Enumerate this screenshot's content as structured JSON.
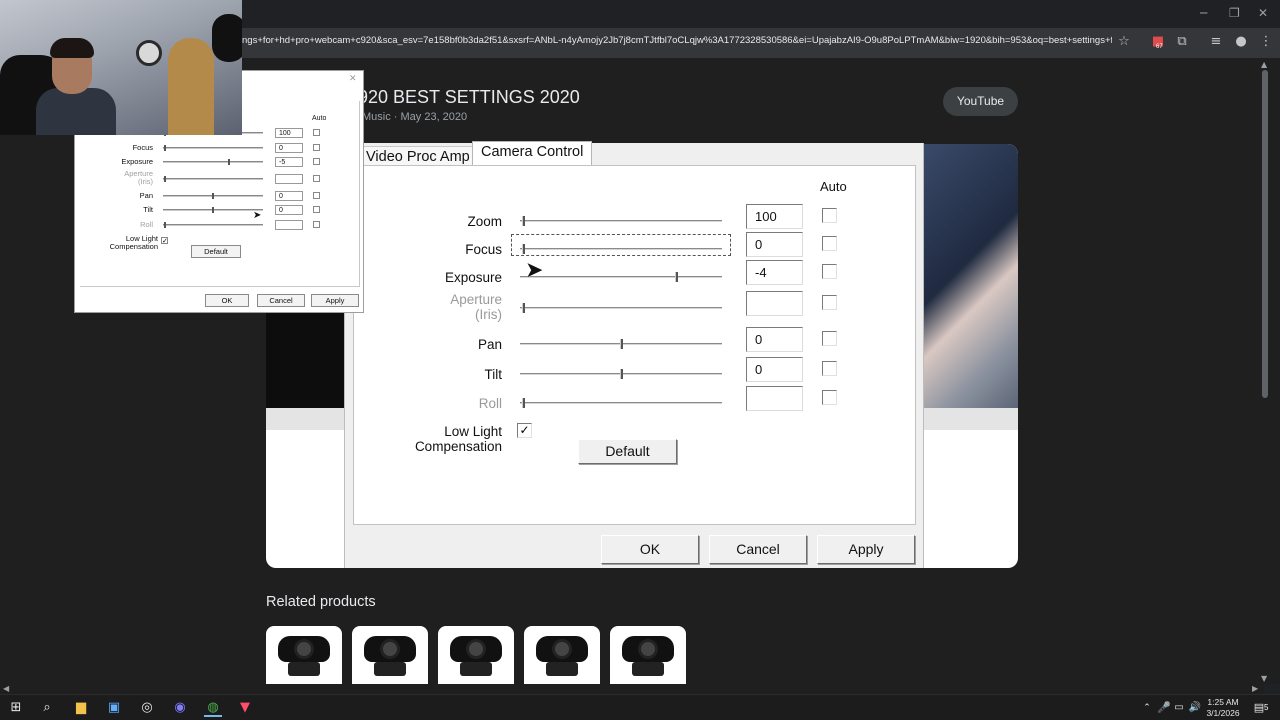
{
  "browser": {
    "url": "ngs+for+hd+pro+webcam+c920&sca_esv=7e158bf0b3da2f51&sxsrf=ANbL-n4yAmojy2Jb7j8cmTJtfbl7oCLqjw%3A1772328530586&ei=UpajabzAI9-O9u8PoLPTmAM&biw=1920&bih=953&oq=best+settings+f...",
    "extensions_badge": "67"
  },
  "video": {
    "title": "920 BEST SETTINGS 2020",
    "meta": "Music · May 23, 2020",
    "source_button": "YouTube"
  },
  "big_dialog": {
    "tab_inactive": "Video Proc Amp",
    "tab_active": "Camera Control",
    "auto_header": "Auto",
    "rows": [
      {
        "label": "Zoom",
        "value": "100",
        "disabled": false,
        "thumb": 0.0
      },
      {
        "label": "Focus",
        "value": "0",
        "disabled": false,
        "thumb": 0.0
      },
      {
        "label": "Exposure",
        "value": "-4",
        "disabled": false,
        "thumb": 0.78
      },
      {
        "label": "Aperture\n(Iris)",
        "value": "",
        "disabled": true,
        "thumb": 0.0
      },
      {
        "label": "Pan",
        "value": "0",
        "disabled": false,
        "thumb": 0.5
      },
      {
        "label": "Tilt",
        "value": "0",
        "disabled": false,
        "thumb": 0.5
      },
      {
        "label": "Roll",
        "value": "",
        "disabled": true,
        "thumb": 0.0
      }
    ],
    "low_light_label_1": "Low Light",
    "low_light_label_2": "Compensation",
    "low_light_checked": "✓",
    "default_button": "Default",
    "ok_button": "OK",
    "cancel_button": "Cancel",
    "apply_button": "Apply"
  },
  "small_dialog": {
    "auto_header": "Auto",
    "rows": [
      {
        "label": "",
        "value": "100",
        "disabled": false,
        "thumb": 0.0
      },
      {
        "label": "Focus",
        "value": "0",
        "disabled": false,
        "thumb": 0.0
      },
      {
        "label": "Exposure",
        "value": "-5",
        "disabled": false,
        "thumb": 0.67
      },
      {
        "label": "Aperture\n(Iris)",
        "value": "",
        "disabled": true,
        "thumb": 0.0
      },
      {
        "label": "Pan",
        "value": "0",
        "disabled": false,
        "thumb": 0.5
      },
      {
        "label": "Tilt",
        "value": "0",
        "disabled": false,
        "thumb": 0.5
      },
      {
        "label": "Roll",
        "value": "",
        "disabled": true,
        "thumb": 0.0
      }
    ],
    "low_light_label_1": "Low Light",
    "low_light_label_2": "Compensation",
    "low_light_checked": "✓",
    "default_button": "Default",
    "ok_button": "OK",
    "cancel_button": "Cancel",
    "apply_button": "Apply"
  },
  "related": {
    "heading": "Related products"
  },
  "taskbar": {
    "time": "1:25 AM",
    "date": "3/1/2026",
    "notification_count": "5"
  },
  "colors": {
    "page_bg": "#1f1f1f",
    "pill_bg": "#3c4043",
    "taskbar_bg": "#1c1c1c"
  }
}
